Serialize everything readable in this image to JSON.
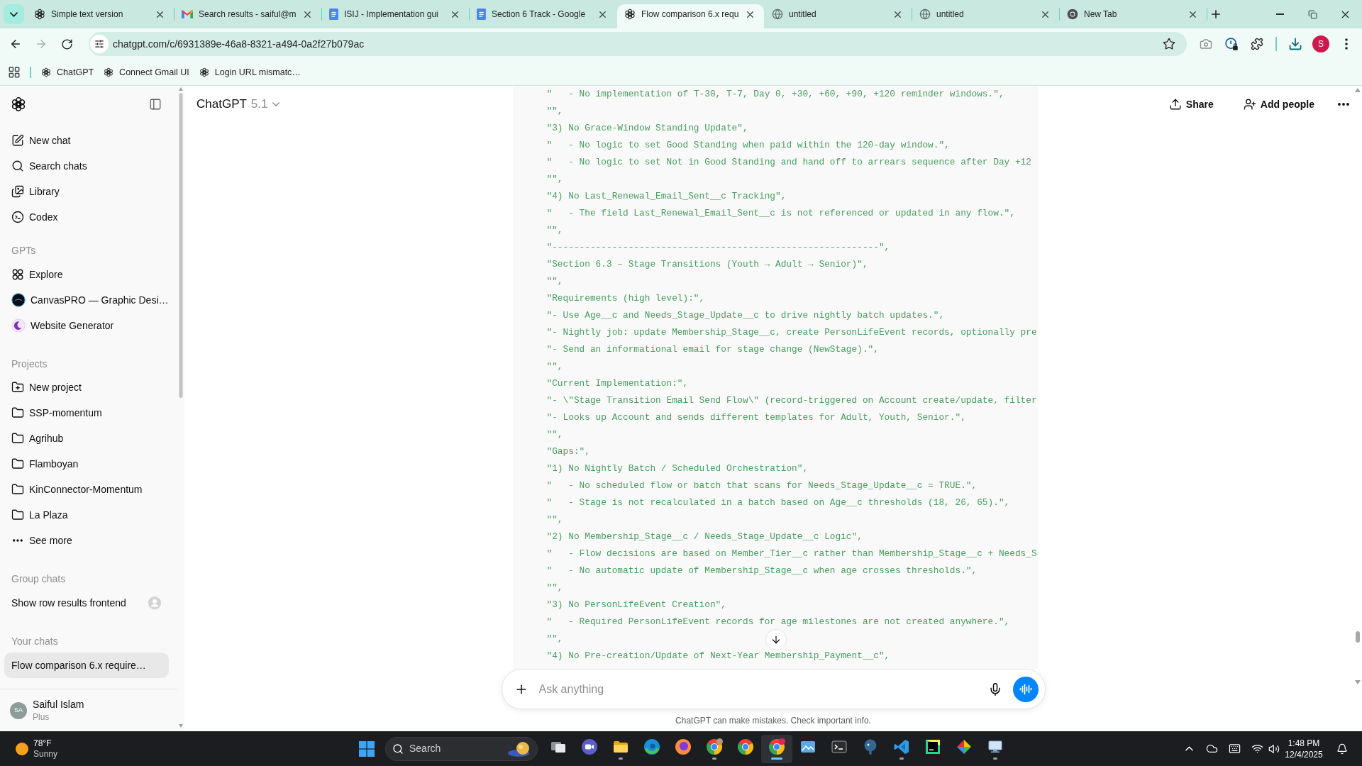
{
  "browser": {
    "tabs": [
      {
        "title": "Simple text version",
        "kind": "chatgpt",
        "selected": false
      },
      {
        "title": "Search results - saiful@m",
        "kind": "gmail",
        "selected": false
      },
      {
        "title": "ISIJ - Implementation gui",
        "kind": "docs",
        "selected": false
      },
      {
        "title": "Section 6 Track - Google",
        "kind": "docs",
        "selected": false
      },
      {
        "title": "Flow comparison 6.x requ",
        "kind": "chatgpt",
        "selected": true
      },
      {
        "title": "untitled",
        "kind": "globe",
        "selected": false
      },
      {
        "title": "untitled",
        "kind": "globe",
        "selected": false
      },
      {
        "title": "New Tab",
        "kind": "chrome",
        "selected": false
      }
    ],
    "navigation": {
      "back_disabled": false,
      "forward_disabled": true
    },
    "address": "chatgpt.com/c/6931389e-46a8-8321-a494-0a2f27b079ac",
    "profile_initial": "S",
    "bookmarks": [
      {
        "label": "ChatGPT"
      },
      {
        "label": "Connect Gmail UI"
      },
      {
        "label": "Login URL mismatc…"
      }
    ]
  },
  "sidebar": {
    "nav": [
      {
        "label": "New chat",
        "kind": "new-chat"
      },
      {
        "label": "Search chats",
        "kind": "search"
      },
      {
        "label": "Library",
        "kind": "library"
      },
      {
        "label": "Codex",
        "kind": "codex"
      }
    ],
    "gpts": {
      "heading": "GPTs",
      "items": [
        {
          "label": "Explore",
          "kind": "explore"
        },
        {
          "label": "CanvasPRO — Graphic Desi…",
          "kind": "canvas"
        },
        {
          "label": "Website Generator",
          "kind": "generator"
        }
      ]
    },
    "projects": {
      "heading": "Projects",
      "items": [
        {
          "label": "New project",
          "kind": "new-project"
        },
        {
          "label": "SSP-momentum",
          "kind": "folder"
        },
        {
          "label": "Agrihub",
          "kind": "folder"
        },
        {
          "label": "Flamboyan",
          "kind": "folder"
        },
        {
          "label": "KinConnector-Momentum",
          "kind": "folder"
        },
        {
          "label": "La Plaza",
          "kind": "folder"
        },
        {
          "label": "See more",
          "kind": "more"
        }
      ]
    },
    "group_chats": {
      "heading": "Group chats",
      "items": [
        {
          "label": "Show row results frontend",
          "selected": false
        }
      ]
    },
    "your_chats": {
      "heading": "Your chats",
      "items": [
        {
          "label": "Flow comparison 6.x require…",
          "selected": true
        }
      ]
    },
    "user": {
      "initials": "SA",
      "name": "Saiful Islam",
      "plan": "Plus"
    }
  },
  "chat": {
    "model": {
      "name": "ChatGPT",
      "version": "5.1"
    },
    "actions": [
      {
        "label": "Share",
        "kind": "share"
      },
      {
        "label": "Add people",
        "kind": "add-people"
      }
    ],
    "code_lines": [
      "\"   - No implementation of T-30, T-7, Day 0, +30, +60, +90, +120 reminder windows.\",",
      "\"\",",
      "\"3) No Grace-Window Standing Update\",",
      "\"   - No logic to set Good Standing when paid within the 120-day window.\",",
      "\"   - No logic to set Not in Good Standing and hand off to arrears sequence after Day +12",
      "\"\",",
      "\"4) No Last_Renewal_Email_Sent__c Tracking\",",
      "\"   - The field Last_Renewal_Email_Sent__c is not referenced or updated in any flow.\",",
      "\"\",",
      "\"------------------------------------------------------------\",",
      "\"Section 6.3 – Stage Transitions (Youth → Adult → Senior)\",",
      "\"\",",
      "\"Requirements (high level):\",",
      "\"- Use Age__c and Needs_Stage_Update__c to drive nightly batch updates.\",",
      "\"- Nightly job: update Membership_Stage__c, create PersonLifeEvent records, optionally pre",
      "\"- Send an informational email for stage change (NewStage).\",",
      "\"\",",
      "\"Current Implementation:\",",
      "\"- \\\"Stage Transition Email Send Flow\\\" (record-triggered on Account create/update, filter",
      "\"- Looks up Account and sends different templates for Adult, Youth, Senior.\",",
      "\"\",",
      "\"Gaps:\",",
      "\"1) No Nightly Batch / Scheduled Orchestration\",",
      "\"   - No scheduled flow or batch that scans for Needs_Stage_Update__c = TRUE.\",",
      "\"   - Stage is not recalculated in a batch based on Age__c thresholds (18, 26, 65).\",",
      "\"\",",
      "\"2) No Membership_Stage__c / Needs_Stage_Update__c Logic\",",
      "\"   - Flow decisions are based on Member_Tier__c rather than Membership_Stage__c + Needs_S",
      "\"   - No automatic update of Membership_Stage__c when age crosses thresholds.\",",
      "\"\",",
      "\"3) No PersonLifeEvent Creation\",",
      "\"   - Required PersonLifeEvent records for age milestones are not created anywhere.\",",
      "\"\",",
      "\"4) No Pre-creation/Update of Next-Year Membership_Payment__c\","
    ],
    "composer": {
      "placeholder": "Ask anything"
    },
    "disclaimer": "ChatGPT can make mistakes. Check important info."
  },
  "taskbar": {
    "weather": {
      "temperature": "78°F",
      "condition": "Sunny"
    },
    "search": {
      "label": "Search"
    },
    "apps": [
      {
        "kind": "task-view",
        "running": false,
        "selected": false
      },
      {
        "kind": "meet",
        "running": false,
        "selected": false
      },
      {
        "kind": "explorer",
        "running": true,
        "selected": false
      },
      {
        "kind": "edge",
        "running": false,
        "selected": false
      },
      {
        "kind": "firefox",
        "running": false,
        "selected": false
      },
      {
        "kind": "chrome-profile",
        "running": true,
        "selected": false
      },
      {
        "kind": "chrome",
        "running": false,
        "selected": false
      },
      {
        "kind": "chrome-badge",
        "running": true,
        "selected": true
      },
      {
        "kind": "photos",
        "running": false,
        "selected": false
      },
      {
        "kind": "terminal",
        "running": false,
        "selected": false
      },
      {
        "kind": "elephant",
        "running": false,
        "selected": false
      },
      {
        "kind": "vscode",
        "running": true,
        "selected": false
      },
      {
        "kind": "pycharm",
        "running": false,
        "selected": false
      },
      {
        "kind": "git",
        "running": false,
        "selected": false
      },
      {
        "kind": "monitor",
        "running": true,
        "selected": false
      }
    ],
    "clock": {
      "time": "1:48 PM",
      "date": "12/4/2025"
    }
  }
}
